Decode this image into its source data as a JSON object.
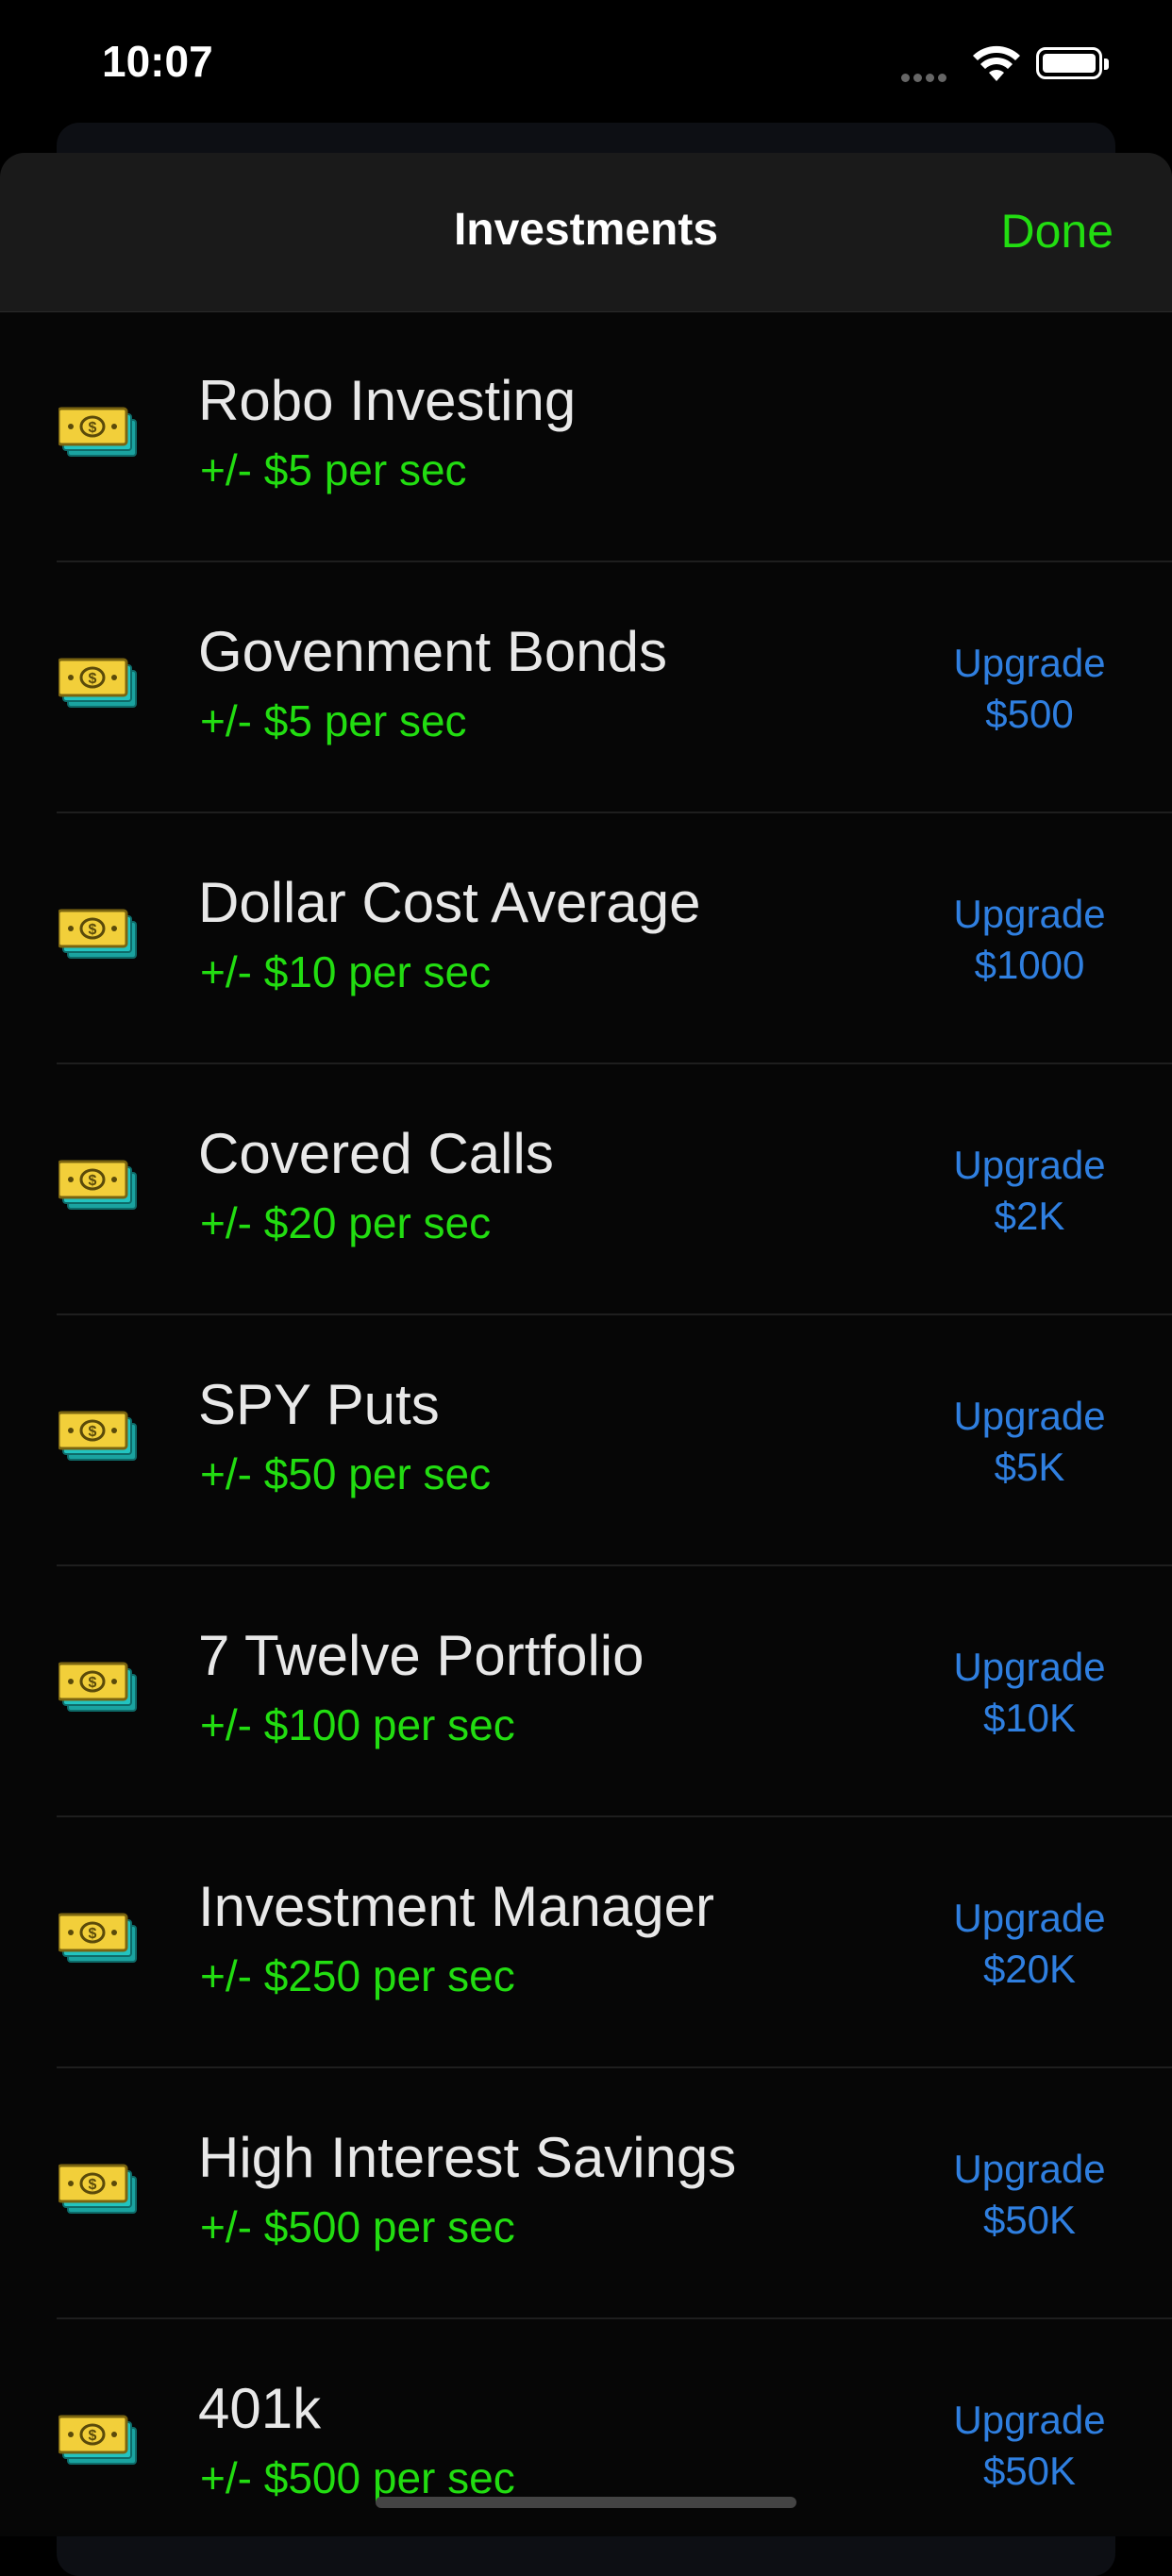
{
  "status_bar": {
    "time": "10:07"
  },
  "nav": {
    "title": "Investments",
    "done_label": "Done"
  },
  "investments": [
    {
      "name": "Robo Investing",
      "rate": "+/- $5 per sec",
      "upgrade_label": "",
      "upgrade_price": ""
    },
    {
      "name": "Govenment Bonds",
      "rate": "+/- $5 per sec",
      "upgrade_label": "Upgrade",
      "upgrade_price": "$500"
    },
    {
      "name": "Dollar Cost Average",
      "rate": "+/- $10 per sec",
      "upgrade_label": "Upgrade",
      "upgrade_price": "$1000"
    },
    {
      "name": "Covered Calls",
      "rate": "+/- $20 per sec",
      "upgrade_label": "Upgrade",
      "upgrade_price": "$2K"
    },
    {
      "name": "SPY Puts",
      "rate": "+/- $50 per sec",
      "upgrade_label": "Upgrade",
      "upgrade_price": "$5K"
    },
    {
      "name": "7 Twelve Portfolio",
      "rate": "+/- $100 per sec",
      "upgrade_label": "Upgrade",
      "upgrade_price": "$10K"
    },
    {
      "name": "Investment Manager",
      "rate": "+/- $250 per sec",
      "upgrade_label": "Upgrade",
      "upgrade_price": "$20K"
    },
    {
      "name": "High Interest Savings",
      "rate": "+/- $500 per sec",
      "upgrade_label": "Upgrade",
      "upgrade_price": "$50K"
    },
    {
      "name": "401k",
      "rate": "+/- $500 per sec",
      "upgrade_label": "Upgrade",
      "upgrade_price": "$50K"
    }
  ],
  "icons": {
    "row_icon": "money-bills-icon"
  },
  "colors": {
    "accent_green": "#22dd11",
    "upgrade_blue": "#2f7fe0",
    "background": "#000000"
  }
}
